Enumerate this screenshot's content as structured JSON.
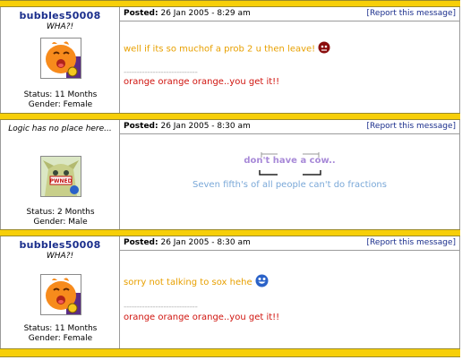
{
  "posts": [
    {
      "username": "bubbles50008",
      "user_title": "WHA?!",
      "status": "Status: 11 Months",
      "gender": "Gender: Female",
      "posted_label": "Posted:",
      "posted_date": "26 Jan 2005 - 8:29 am",
      "report_label": "[Report this message]",
      "message": "well if its so muchof a prob 2 u then leave!",
      "divider": "----------------------------",
      "signature": "orange orange orange..you get it!!",
      "smiley_icon": "angry-red-face-icon"
    },
    {
      "username": "",
      "user_title": "Logic has no place here...",
      "status": "Status: 2 Months",
      "gender": "Gender: Male",
      "posted_label": "Posted:",
      "posted_date": "26 Jan 2005 - 8:30 am",
      "report_label": "[Report this message]",
      "avatar_text": "PWNED",
      "sig_banner": "don't have a cow..",
      "sig_quote": "Seven fifth's of all people can't do fractions"
    },
    {
      "username": "bubbles50008",
      "user_title": "WHA?!",
      "status": "Status: 11 Months",
      "gender": "Gender: Female",
      "posted_label": "Posted:",
      "posted_date": "26 Jan 2005 - 8:30 am",
      "report_label": "[Report this message]",
      "message": "sorry not talking to sox hehe",
      "divider": "----------------------------",
      "signature": "orange orange orange..you get it!!",
      "smiley_icon": "blue-grin-face-icon"
    }
  ],
  "colors": {
    "separator": "#f7cf08",
    "username": "#1a2e8c",
    "message": "#e8a000",
    "signature": "#d0140e",
    "banner": "#a88ad8",
    "quote": "#7aa8d8"
  }
}
